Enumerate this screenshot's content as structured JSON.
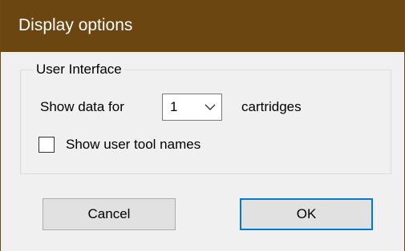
{
  "window": {
    "title": "Display options"
  },
  "group": {
    "legend": "User Interface",
    "show_data_prefix": "Show data for",
    "cartridges_select": {
      "selected_value": "1"
    },
    "show_data_suffix": "cartridges",
    "user_tool_names_checkbox": {
      "label": "Show user tool names",
      "checked": false
    }
  },
  "buttons": {
    "cancel_label": "Cancel",
    "ok_label": "OK"
  },
  "colors": {
    "titlebar": "#6b4611",
    "client_bg": "#f0f0f0",
    "default_button_border": "#0078d7"
  },
  "icons": {
    "dropdown": "chevron-down-icon"
  }
}
